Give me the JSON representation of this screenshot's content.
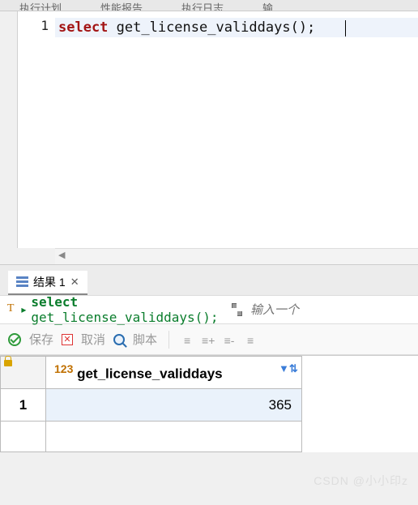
{
  "top_tabs": {
    "t1": "执行计划",
    "t2": "性能报告",
    "t3": "执行日志",
    "t4": "输"
  },
  "editor": {
    "line_number": "1",
    "kw": "select",
    "rest": " get_license_validdays();"
  },
  "result_tab": {
    "label": "结果 1",
    "close": "✕"
  },
  "query_echo": {
    "arrow": "▸",
    "kw": "select",
    "rest": " get_license_validdays();",
    "search_placeholder": "输入一个"
  },
  "toolbar": {
    "save": "保存",
    "cancel": "取消",
    "script": "脚本"
  },
  "grid": {
    "col_type_hint": "123",
    "col_name": "get_license_validdays",
    "filter_glyph": "⇅",
    "row1_index": "1",
    "row1_value": "365"
  },
  "watermark": "CSDN @小小印z"
}
